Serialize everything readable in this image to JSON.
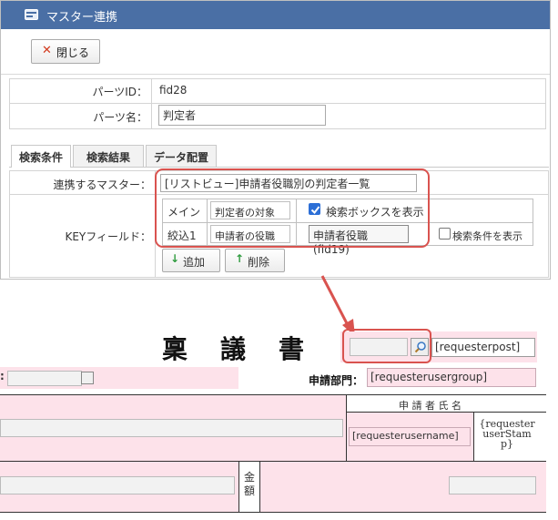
{
  "dialog": {
    "title": "マスター連携",
    "close_label": "閉じる",
    "parts_id_label": "パーツID：",
    "parts_id_value": "fid28",
    "parts_name_label": "パーツ名：",
    "parts_name_value": "判定者"
  },
  "tabs": [
    {
      "label": "検索条件"
    },
    {
      "label": "検索結果"
    },
    {
      "label": "データ配置"
    }
  ],
  "search": {
    "master_label": "連携するマスター：",
    "master_value": "[リストビュー]申請者役職別の判定者一覧",
    "key_label": "KEYフィールド：",
    "rows": [
      {
        "type": "メイン",
        "field": "判定者の対象",
        "check_label": "検索ボックスを表示",
        "checked": true
      },
      {
        "type": "絞込1",
        "field": "申請者の役職",
        "select_value": "申請者役職 (fid19)",
        "check_label": "検索条件を表示",
        "checked": false
      }
    ],
    "add_label": "追加",
    "delete_label": "削除"
  },
  "form": {
    "title": "稟　議　書",
    "requesterpost": "[requesterpost]",
    "dept_label": "申請部門：",
    "dept_value": "[requesterusergroup]",
    "applicant_label": "申 請 者 氏 名",
    "username": "[requesterusername]",
    "stamp": "{requester userStam p}",
    "amount_label": "金額"
  },
  "colors": {
    "titlebar": "#4a6fa5",
    "highlight": "#d9534f",
    "pink": "#fde2ea",
    "arrow": "#d9534f"
  }
}
